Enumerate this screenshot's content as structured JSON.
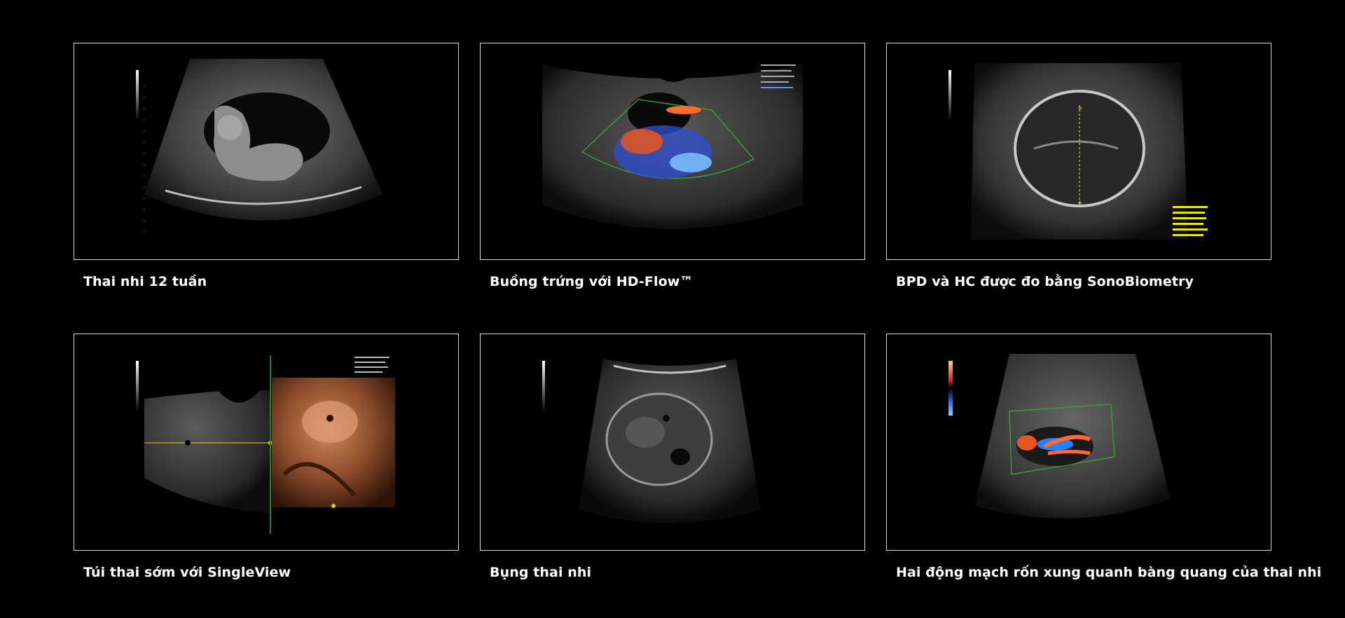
{
  "gallery": {
    "items": [
      {
        "caption": "Thai nhi 12 tuần",
        "image": "ultrasound-fetus-12-weeks"
      },
      {
        "caption": "Buồng trứng với HD-Flow™",
        "image": "ultrasound-ovary-hd-flow"
      },
      {
        "caption": "BPD và HC được đo bằng SonoBiometry",
        "image": "ultrasound-fetal-head-biometry"
      },
      {
        "caption": "Túi thai sớm với SingleView",
        "image": "ultrasound-early-gestational-sac-singleview"
      },
      {
        "caption": "Bụng thai nhi",
        "image": "ultrasound-fetal-abdomen"
      },
      {
        "caption": "Hai động mạch rốn xung quanh bàng quang của thai nhi",
        "image": "ultrasound-umbilical-arteries-bladder"
      }
    ]
  },
  "colors": {
    "background": "#000000",
    "frame_border": "#d9d9d9",
    "caption_text": "#ffffff",
    "measurement_yellow": "#e8e800",
    "doppler_red": "#ff5a1f",
    "doppler_blue": "#2a7fff",
    "render_3d": "#b5653a"
  }
}
